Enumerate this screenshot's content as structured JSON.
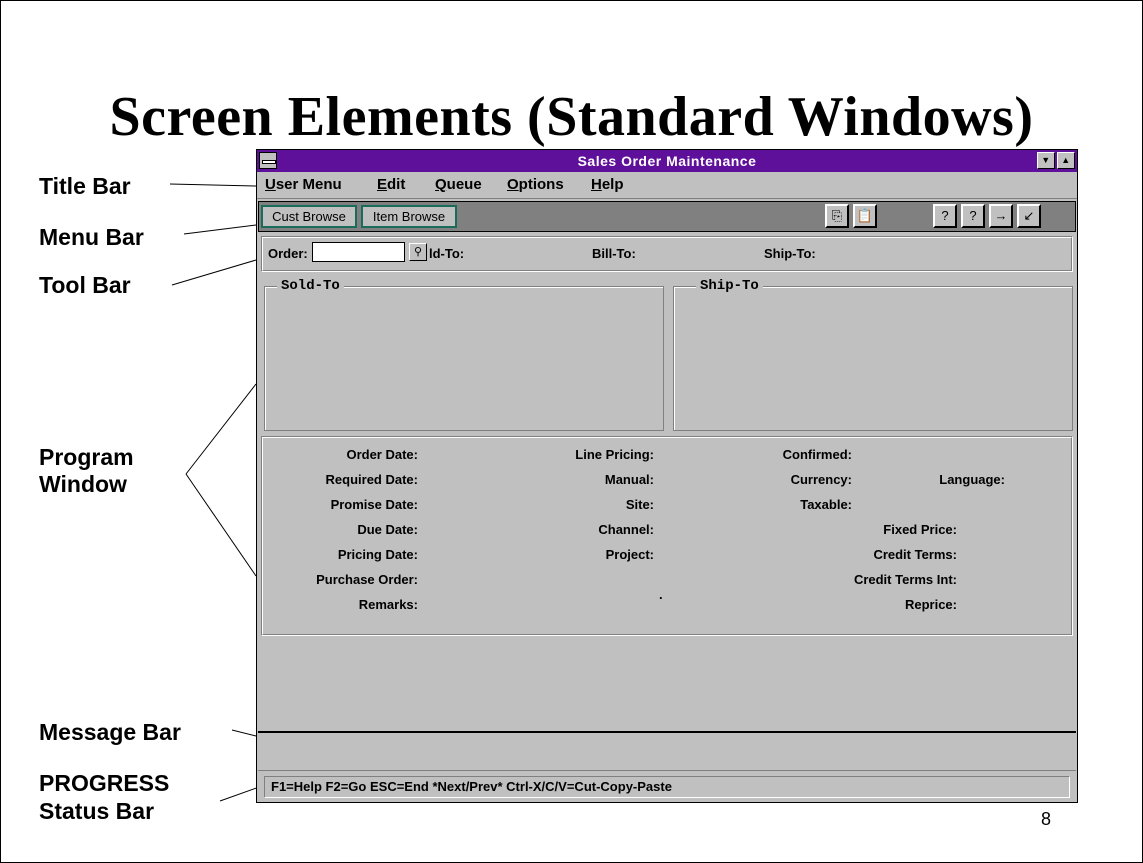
{
  "slide": {
    "title": "Screen Elements (Standard Windows)",
    "page_number": "8"
  },
  "callouts": {
    "title_bar": "Title Bar",
    "menu_bar": "Menu Bar",
    "tool_bar": "Tool Bar",
    "program_window_1": "Program",
    "program_window_2": "Window",
    "message_bar": "Message Bar",
    "status_bar_1": "PROGRESS",
    "status_bar_2": "Status Bar"
  },
  "window": {
    "title": "Sales Order Maintenance",
    "accent_color": "#5f109a",
    "icons": {
      "system_menu": "system-menu-icon",
      "minimize": "minimize-icon",
      "maximize": "maximize-icon"
    }
  },
  "menu": {
    "items": [
      "User Menu",
      "Edit",
      "Queue",
      "Options",
      "Help"
    ]
  },
  "toolbar": {
    "cust_browse": "Cust Browse",
    "item_browse": "Item Browse",
    "icons": [
      "copy-icon",
      "paste-icon",
      "help-query-icon",
      "field-help-icon",
      "go-next-icon",
      "end-exit-icon"
    ]
  },
  "header_fields": {
    "order_label": "Order:",
    "order_value": "",
    "sold_to_partial": "ld-To:",
    "bill_to": "Bill-To:",
    "ship_to": "Ship-To:"
  },
  "groups": {
    "sold_to": "Sold-To",
    "ship_to": "Ship-To"
  },
  "details": {
    "col1": [
      "Order Date:",
      "Required Date:",
      "Promise Date:",
      "Due Date:",
      "Pricing Date:",
      "Purchase Order:",
      "Remarks:"
    ],
    "col2": [
      "Line Pricing:",
      "Manual:",
      "Site:",
      "Channel:",
      "Project:"
    ],
    "col3": [
      "Confirmed:",
      "Currency:",
      "Taxable:"
    ],
    "col4": [
      "Language:",
      "Fixed Price:",
      "Credit Terms:",
      "Credit Terms Int:",
      "Reprice:"
    ],
    "dot": "."
  },
  "message_bar": {
    "text": ""
  },
  "status_bar": {
    "text": "F1=Help F2=Go ESC=End  *Next/Prev*  Ctrl-X/C/V=Cut-Copy-Paste"
  }
}
